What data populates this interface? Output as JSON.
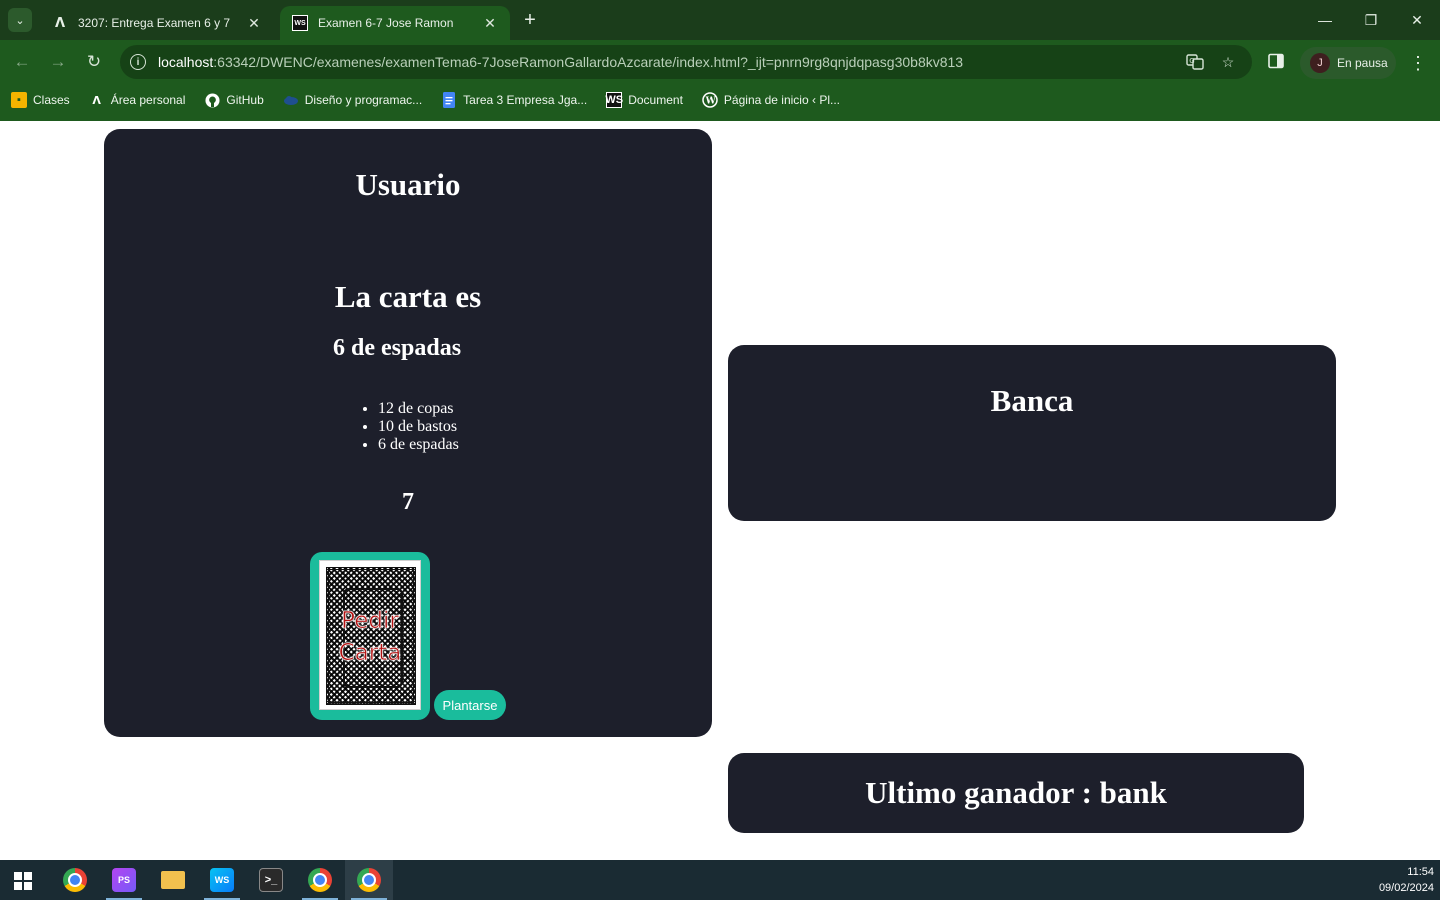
{
  "browser": {
    "tabs": [
      {
        "title": "3207: Entrega Examen 6 y 7",
        "favicon": "moodle-a-icon",
        "active": false
      },
      {
        "title": "Examen 6-7 Jose Ramon",
        "favicon": "webstorm-icon",
        "active": true
      }
    ],
    "address": {
      "host": "localhost",
      "rest": ":63342/DWENC/examenes/examenTema6-7JoseRamonGallardoAzcarate/index.html?_ijt=pnrn9rg8qnjdqpasg30b8kv813"
    },
    "profile": {
      "initial": "J",
      "label": "En pausa"
    },
    "bookmarks": [
      {
        "label": "Clases",
        "icon": "classroom-icon",
        "color": "#f4b400"
      },
      {
        "label": "Área personal",
        "icon": "moodle-a-icon",
        "color": "#ffffff"
      },
      {
        "label": "GitHub",
        "icon": "github-icon",
        "color": "#ffffff"
      },
      {
        "label": "Diseño y programac...",
        "icon": "cloud-icon",
        "color": "#1f4f8f"
      },
      {
        "label": "Tarea 3 Empresa Jga...",
        "icon": "docs-icon",
        "color": "#4285f4"
      },
      {
        "label": "Document",
        "icon": "webstorm-icon",
        "color": "#111111"
      },
      {
        "label": "Página de inicio ‹ Pl...",
        "icon": "wordpress-icon",
        "color": "#ffffff"
      }
    ]
  },
  "game": {
    "user_title": "Usuario",
    "card_heading": "La carta es",
    "current_card": "6 de espadas",
    "cards": [
      "12 de copas",
      "10 de bastos",
      "6 de espadas"
    ],
    "points": "7",
    "deck_button_label_line1": "Pedir",
    "deck_button_label_line2": "Carta",
    "stand_button_label": "Plantarse",
    "bank_title": "Banca",
    "winner_text": "Ultimo ganador : bank"
  },
  "taskbar": {
    "apps": [
      "chrome-icon",
      "phpstorm-icon",
      "file-explorer-icon",
      "webstorm-icon",
      "terminal-icon",
      "chrome-profile-icon",
      "chrome-profile-active-icon"
    ],
    "time": "11:54",
    "date": "09/02/2024"
  },
  "colors": {
    "panel_bg": "#1d1f2b",
    "accent": "#1abc9c",
    "chrome_bg": "#1e5a1e"
  }
}
